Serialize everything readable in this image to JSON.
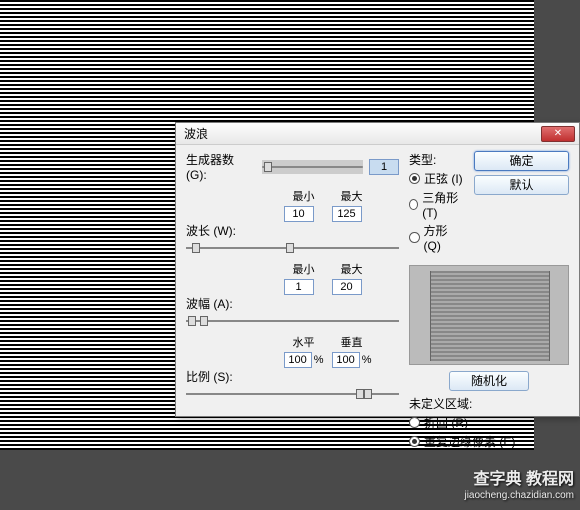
{
  "dialog": {
    "title": "波浪",
    "close_icon": "✕"
  },
  "generators": {
    "label": "生成器数 (G):",
    "value": "1"
  },
  "wavelength": {
    "label": "波长 (W):",
    "min_label": "最小",
    "max_label": "最大",
    "min_value": "10",
    "max_value": "125"
  },
  "amplitude": {
    "label": "波幅 (A):",
    "min_label": "最小",
    "max_label": "最大",
    "min_value": "1",
    "max_value": "20"
  },
  "scale": {
    "label": "比例 (S):",
    "h_label": "水平",
    "v_label": "垂直",
    "h_value": "100",
    "v_value": "100",
    "pct": "%"
  },
  "type": {
    "legend": "类型:",
    "sine": "正弦 (I)",
    "triangle": "三角形 (T)",
    "square": "方形 (Q)"
  },
  "buttons": {
    "ok": "确定",
    "default": "默认",
    "randomize": "随机化"
  },
  "undefined_area": {
    "legend": "未定义区域:",
    "wrap": "折回 (R)",
    "repeat": "重复边缘像素 (E)"
  },
  "watermark": {
    "line1": "查字典 教程网",
    "line2": "jiaocheng.chazidian.com"
  }
}
